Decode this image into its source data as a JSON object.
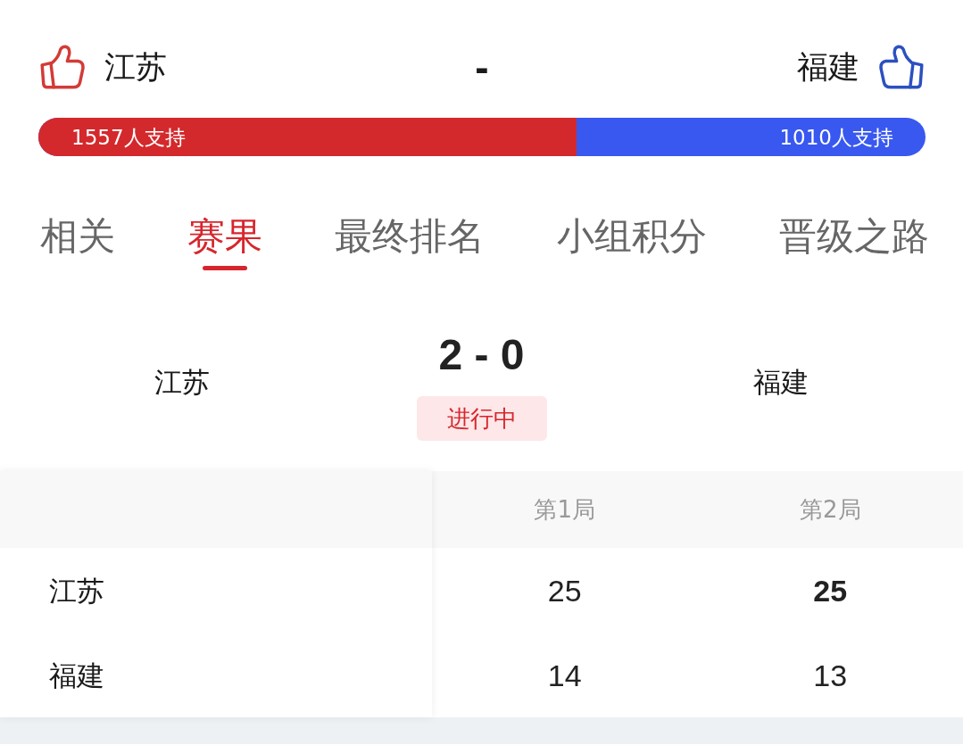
{
  "match_header": {
    "home": {
      "name": "江苏"
    },
    "separator": "-",
    "away": {
      "name": "福建"
    }
  },
  "support_bar": {
    "level": 0.607,
    "home_label": "1557人支持",
    "away_label": "1010人支持"
  },
  "tabs": [
    {
      "label": "相关",
      "selected": false
    },
    {
      "label": "赛果",
      "selected": true
    },
    {
      "label": "最终排名",
      "selected": false
    },
    {
      "label": "小组积分",
      "selected": false
    },
    {
      "label": "晋级之路",
      "selected": false
    }
  ],
  "scoreboard": {
    "home": "江苏",
    "score": "2 - 0",
    "away": "福建",
    "status": "进行中"
  },
  "sets_table": {
    "columns": [
      "第1局",
      "第2局"
    ],
    "rows": [
      {
        "team": "江苏",
        "scores": [
          {
            "value": "25",
            "bold": false
          },
          {
            "value": "25",
            "bold": true
          }
        ]
      },
      {
        "team": "福建",
        "scores": [
          {
            "value": "14",
            "bold": false
          },
          {
            "value": "13",
            "bold": false
          }
        ]
      }
    ]
  }
}
